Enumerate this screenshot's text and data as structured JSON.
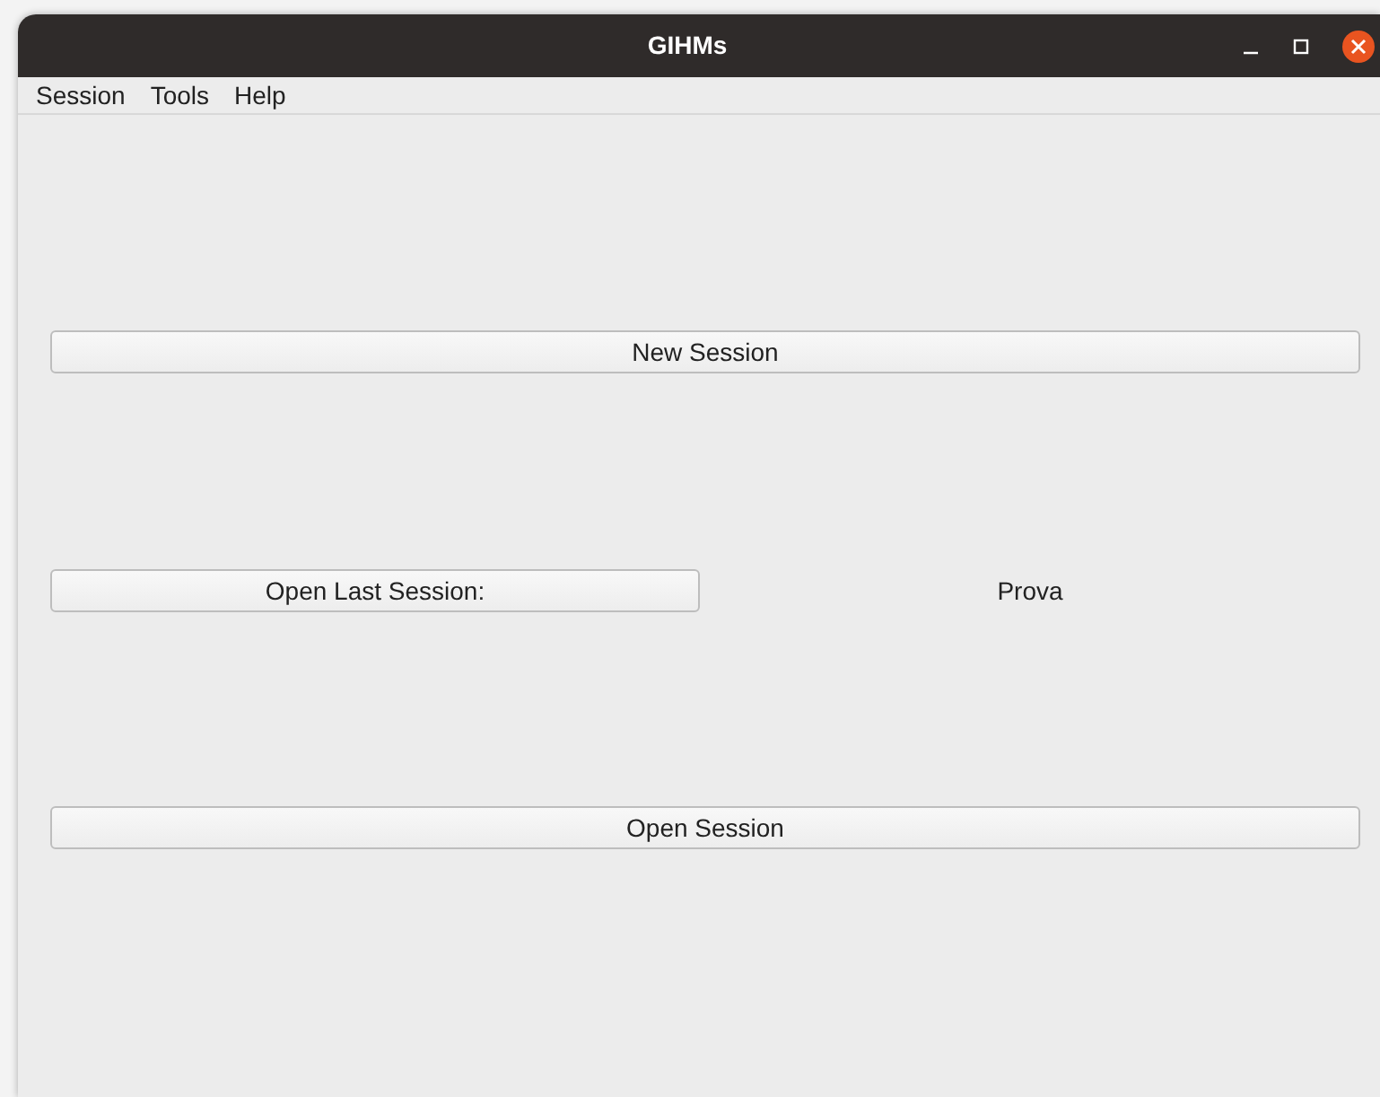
{
  "window": {
    "title": "GIHMs"
  },
  "menu": [
    "Session",
    "Tools",
    "Help"
  ],
  "new_session_button": "New Session",
  "open_last_session": {
    "button": "Open Last Session:",
    "session_name": "Prova"
  },
  "open_session_button": "Open Session"
}
